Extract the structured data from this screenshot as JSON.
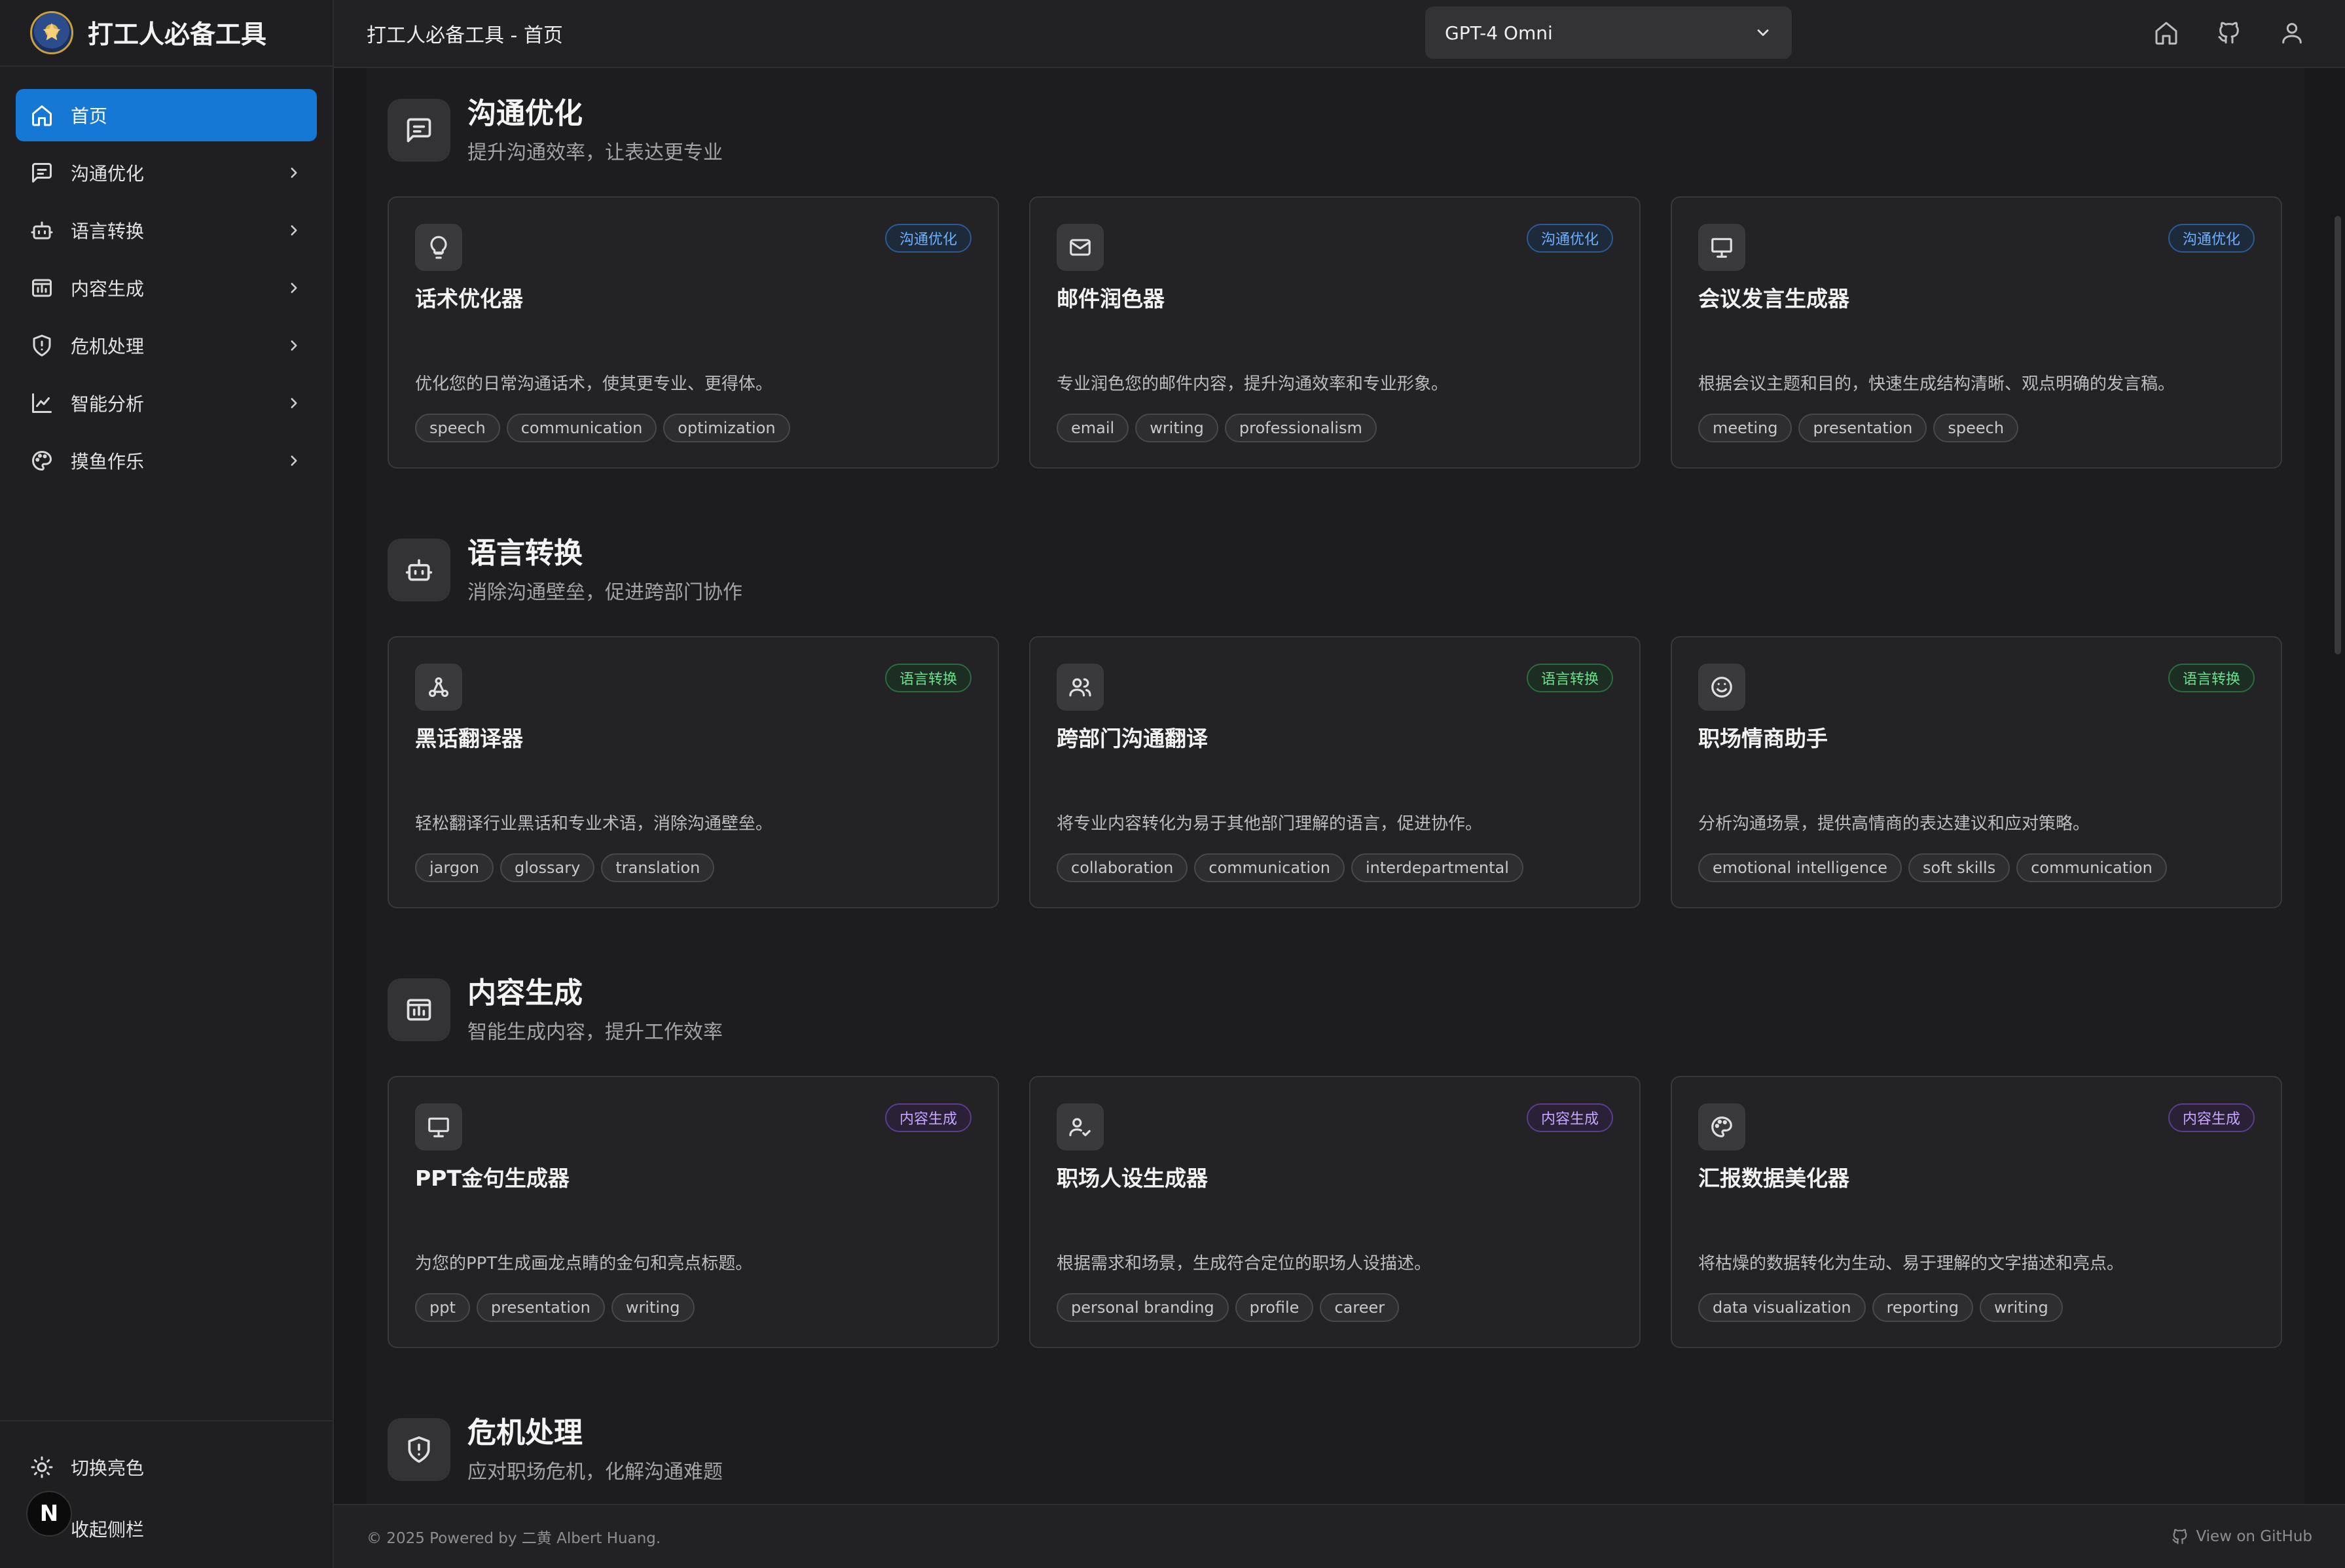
{
  "app": {
    "title": "打工人必备工具",
    "page_title": "打工人必备工具 - 首页"
  },
  "header": {
    "model_select": "GPT-4 Omni",
    "icons": [
      "home-icon",
      "github-icon",
      "user-icon"
    ]
  },
  "sidebar": {
    "items": [
      {
        "label": "首页",
        "icon": "home-icon",
        "active": true
      },
      {
        "label": "沟通优化",
        "icon": "message-icon"
      },
      {
        "label": "语言转换",
        "icon": "robot-icon"
      },
      {
        "label": "内容生成",
        "icon": "folder-chart-icon"
      },
      {
        "label": "危机处理",
        "icon": "shield-icon"
      },
      {
        "label": "智能分析",
        "icon": "line-chart-icon"
      },
      {
        "label": "摸鱼作乐",
        "icon": "palette-icon"
      }
    ],
    "bottom": {
      "theme_toggle": "切换亮色",
      "collapse": "收起侧栏",
      "badge": "N"
    }
  },
  "sections": [
    {
      "title": "沟通优化",
      "subtitle": "提升沟通效率，让表达更专业",
      "icon": "message-icon",
      "cards": [
        {
          "title": "话术优化器",
          "badge": "沟通优化",
          "icon": "lightbulb-icon",
          "desc": "优化您的日常沟通话术，使其更专业、更得体。",
          "tags": [
            "speech",
            "communication",
            "optimization"
          ]
        },
        {
          "title": "邮件润色器",
          "badge": "沟通优化",
          "icon": "mail-icon",
          "desc": "专业润色您的邮件内容，提升沟通效率和专业形象。",
          "tags": [
            "email",
            "writing",
            "professionalism"
          ]
        },
        {
          "title": "会议发言生成器",
          "badge": "沟通优化",
          "icon": "presentation-icon",
          "desc": "根据会议主题和目的，快速生成结构清晰、观点明确的发言稿。",
          "tags": [
            "meeting",
            "presentation",
            "speech"
          ]
        }
      ]
    },
    {
      "title": "语言转换",
      "subtitle": "消除沟通壁垒，促进跨部门协作",
      "icon": "robot-icon",
      "cards": [
        {
          "title": "黑话翻译器",
          "badge": "语言转换",
          "icon": "workflow-icon",
          "desc": "轻松翻译行业黑话和专业术语，消除沟通壁垒。",
          "tags": [
            "jargon",
            "glossary",
            "translation"
          ]
        },
        {
          "title": "跨部门沟通翻译",
          "badge": "语言转换",
          "icon": "users-icon",
          "desc": "将专业内容转化为易于其他部门理解的语言，促进协作。",
          "tags": [
            "collaboration",
            "communication",
            "interdepartmental"
          ]
        },
        {
          "title": "职场情商助手",
          "badge": "语言转换",
          "icon": "smile-icon",
          "desc": "分析沟通场景，提供高情商的表达建议和应对策略。",
          "tags": [
            "emotional intelligence",
            "soft skills",
            "communication"
          ]
        }
      ]
    },
    {
      "title": "内容生成",
      "subtitle": "智能生成内容，提升工作效率",
      "icon": "folder-chart-icon",
      "cards": [
        {
          "title": "PPT金句生成器",
          "badge": "内容生成",
          "icon": "presentation-icon",
          "desc": "为您的PPT生成画龙点睛的金句和亮点标题。",
          "tags": [
            "ppt",
            "presentation",
            "writing"
          ]
        },
        {
          "title": "职场人设生成器",
          "badge": "内容生成",
          "icon": "user-check-icon",
          "desc": "根据需求和场景，生成符合定位的职场人设描述。",
          "tags": [
            "personal branding",
            "profile",
            "career"
          ]
        },
        {
          "title": "汇报数据美化器",
          "badge": "内容生成",
          "icon": "palette-icon",
          "desc": "将枯燥的数据转化为生动、易于理解的文字描述和亮点。",
          "tags": [
            "data visualization",
            "reporting",
            "writing"
          ]
        }
      ]
    },
    {
      "title": "危机处理",
      "subtitle": "应对职场危机，化解沟通难题",
      "icon": "shield-icon",
      "cards": []
    }
  ],
  "footer": {
    "copyright": "© 2025 Powered by 二黄 Albert Huang.",
    "github_link": "View on GitHub"
  },
  "colors": {
    "accent": "#1478d4",
    "badge_blue": "#6fb0ff",
    "badge_green": "#6be08f",
    "badge_purple": "#c7a4ff"
  }
}
